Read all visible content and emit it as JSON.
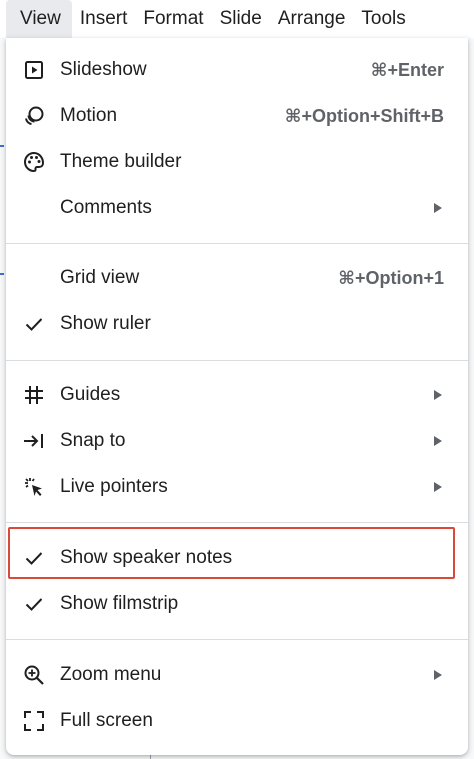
{
  "menubar": {
    "items": [
      {
        "label": "View"
      },
      {
        "label": "Insert"
      },
      {
        "label": "Format"
      },
      {
        "label": "Slide"
      },
      {
        "label": "Arrange"
      },
      {
        "label": "Tools"
      }
    ]
  },
  "menu": {
    "items": [
      {
        "label": "Slideshow",
        "shortcut": "⌘+Enter",
        "icon": "slideshow-icon"
      },
      {
        "label": "Motion",
        "shortcut": "⌘+Option+Shift+B",
        "icon": "motion-icon"
      },
      {
        "label": "Theme builder",
        "icon": "palette-icon"
      },
      {
        "label": "Comments",
        "submenu": true
      },
      {
        "label": "Grid view",
        "shortcut": "⌘+Option+1"
      },
      {
        "label": "Show ruler",
        "checked": true,
        "icon": "check-icon"
      },
      {
        "label": "Guides",
        "submenu": true,
        "icon": "grid-icon"
      },
      {
        "label": "Snap to",
        "submenu": true,
        "icon": "snap-icon"
      },
      {
        "label": "Live pointers",
        "submenu": true,
        "icon": "pointer-icon"
      },
      {
        "label": "Show speaker notes",
        "checked": true,
        "icon": "check-icon",
        "highlighted": true
      },
      {
        "label": "Show filmstrip",
        "checked": true,
        "icon": "check-icon"
      },
      {
        "label": "Zoom menu",
        "submenu": true,
        "icon": "zoom-icon"
      },
      {
        "label": "Full screen",
        "icon": "fullscreen-icon"
      }
    ]
  },
  "colors": {
    "highlight_border": "#d94a38",
    "active_menu_bg": "#e8eaed"
  }
}
